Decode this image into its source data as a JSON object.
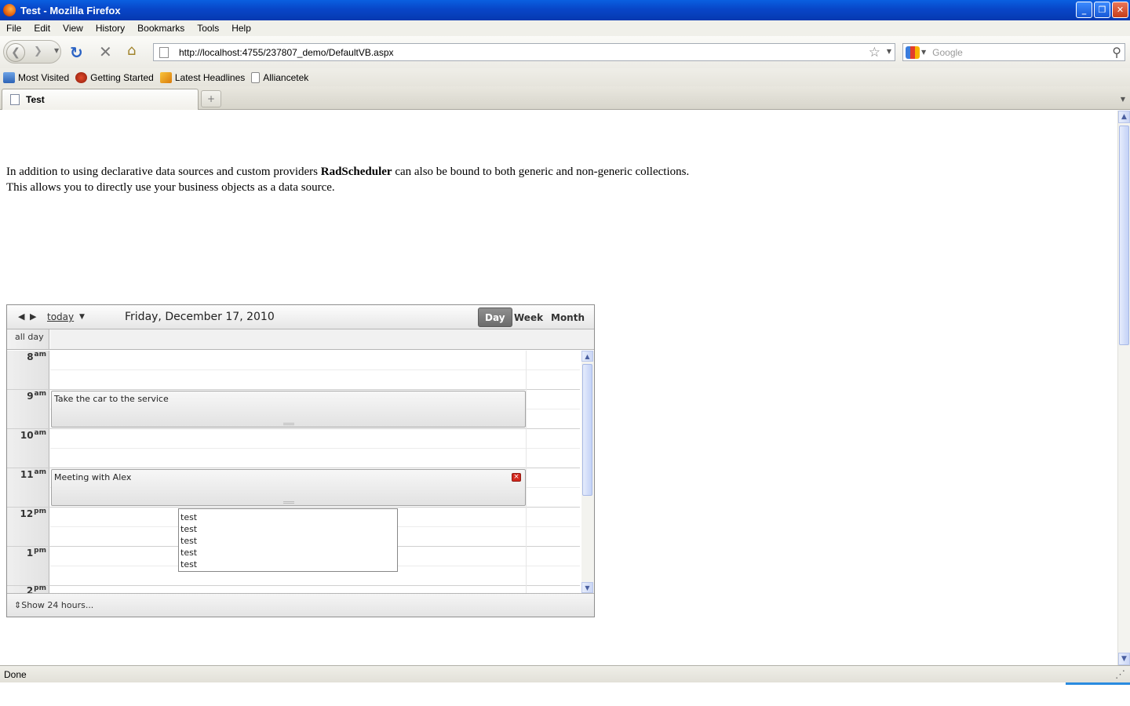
{
  "window": {
    "title": "Test - Mozilla Firefox"
  },
  "menu": {
    "items": [
      "File",
      "Edit",
      "View",
      "History",
      "Bookmarks",
      "Tools",
      "Help"
    ]
  },
  "nav": {
    "url": "http://localhost:4755/237807_demo/DefaultVB.aspx",
    "search_placeholder": "Google"
  },
  "bookmarks": [
    "Most Visited",
    "Getting Started",
    "Latest Headlines",
    "Alliancetek"
  ],
  "tabs": [
    {
      "label": "Test"
    }
  ],
  "page": {
    "intro_line1_pre": "In addition to using declarative data sources and custom providers ",
    "intro_bold": "RadScheduler",
    "intro_line1_post": " can also be bound to both generic and non-generic collections.",
    "intro_line2": "This allows you to directly use your business objects as a data source."
  },
  "scheduler": {
    "today_label": "today",
    "date": "Friday, December 17, 2010",
    "views": [
      "Day",
      "Week",
      "Month"
    ],
    "active_view": "Day",
    "allday_label": "all day",
    "hours": [
      {
        "h": "8",
        "ap": "am"
      },
      {
        "h": "9",
        "ap": "am"
      },
      {
        "h": "10",
        "ap": "am"
      },
      {
        "h": "11",
        "ap": "am"
      },
      {
        "h": "12",
        "ap": "pm"
      },
      {
        "h": "1",
        "ap": "pm"
      },
      {
        "h": "2",
        "ap": "pm"
      }
    ],
    "appointments": [
      {
        "subject": "Take the car to the service"
      },
      {
        "subject": "Meeting with Alex"
      }
    ],
    "popup_items": [
      "test",
      "test",
      "test",
      "test",
      "test"
    ],
    "footer_label": "Show 24 hours..."
  },
  "status": {
    "text": "Done"
  }
}
